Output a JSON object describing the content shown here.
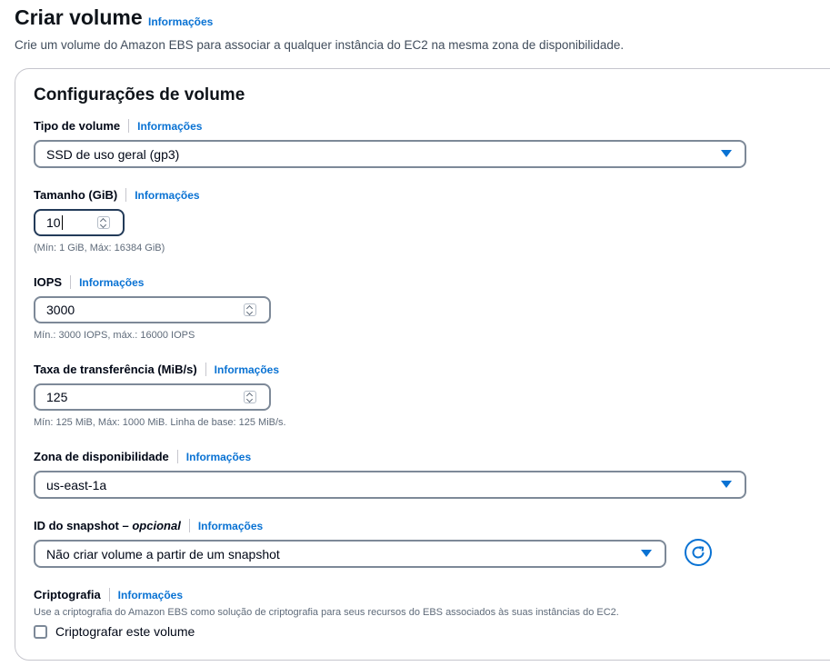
{
  "header": {
    "title": "Criar volume",
    "info": "Informações",
    "description": "Crie um volume do Amazon EBS para associar a qualquer instância do EC2 na mesma zona de disponibilidade."
  },
  "panel": {
    "title": "Configurações de volume"
  },
  "fields": {
    "volume_type": {
      "label": "Tipo de volume",
      "info": "Informações",
      "value": "SSD de uso geral (gp3)"
    },
    "size": {
      "label": "Tamanho (GiB)",
      "info": "Informações",
      "value": "10",
      "hint": "(Mín: 1 GiB, Máx: 16384 GiB)"
    },
    "iops": {
      "label": "IOPS",
      "info": "Informações",
      "value": "3000",
      "hint": "Mín.: 3000 IOPS, máx.: 16000 IOPS"
    },
    "throughput": {
      "label": "Taxa de transferência (MiB/s)",
      "info": "Informações",
      "value": "125",
      "hint": "Mín: 125 MiB, Máx: 1000 MiB. Linha de base: 125 MiB/s."
    },
    "availability_zone": {
      "label": "Zona de disponibilidade",
      "info": "Informações",
      "value": "us-east-1a"
    },
    "snapshot": {
      "label": "ID do snapshot",
      "label_dash": " – ",
      "label_optional": "opcional",
      "info": "Informações",
      "value": "Não criar volume a partir de um snapshot"
    },
    "encryption": {
      "label": "Criptografia",
      "info": "Informações",
      "description": "Use a criptografia do Amazon EBS como solução de criptografia para seus recursos do EBS associados às suas instâncias do EC2.",
      "checkbox_label": "Criptografar este volume",
      "checked": false
    }
  },
  "icons": {
    "select_caret": "caret-down-icon",
    "spinner": "spinner-icon",
    "refresh": "refresh-icon"
  },
  "colors": {
    "link": "#0972d3",
    "border": "#7d8998",
    "text": "#000716"
  }
}
